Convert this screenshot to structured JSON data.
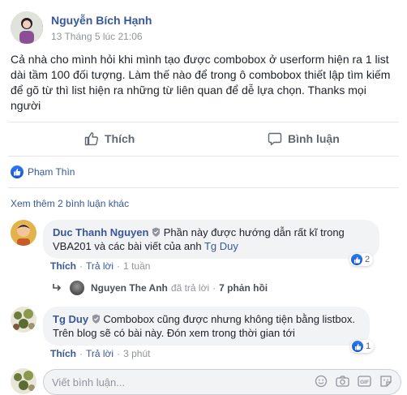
{
  "post": {
    "author": "Nguyễn Bích Hạnh",
    "timestamp": "13 Tháng 5 lúc 21:06",
    "text": "Cả nhà cho mình hỏi khi mình tạo được combobox ở userform hiện ra 1 list dài tầm 100 đối tượng. Làm thế nào để trong ô combobox thiết lập tìm kiếm để gõ từ thì list hiện ra những từ liên quan để dễ lựa chọn. Thanks mọi người"
  },
  "actions": {
    "like_label": "Thích",
    "comment_label": "Bình luận"
  },
  "reactions": {
    "liker": "Phạm Thìn"
  },
  "comments_section": {
    "more_comments": "Xem thêm 2 bình luận khác",
    "comments": [
      {
        "author": "Duc Thanh Nguyen",
        "text": "Phần này được hướng dẫn rất kĩ trong VBA201 và các bài viết của anh",
        "mention": "Tg Duy",
        "like_label": "Thích",
        "reply_label": "Trả lời",
        "time": "1 tuần",
        "reaction_count": "2",
        "reply_summary": {
          "author": "Nguyen The Anh",
          "action": "đã trả lời",
          "separator": "·",
          "count": "7 phản hồi"
        }
      },
      {
        "author": "Tg Duy",
        "text": "Combobox cũng được nhưng không tiện bằng listbox. Trên blog sẽ có bài này. Đón xem trong thời gian tới",
        "like_label": "Thích",
        "reply_label": "Trả lời",
        "time": "3 phút",
        "reaction_count": "1"
      }
    ]
  },
  "composer": {
    "placeholder": "Viết bình luận..."
  },
  "colors": {
    "link": "#385898",
    "meta": "#90949c",
    "like_blue": "#1877f2",
    "bubble_bg": "#f2f3f5"
  }
}
